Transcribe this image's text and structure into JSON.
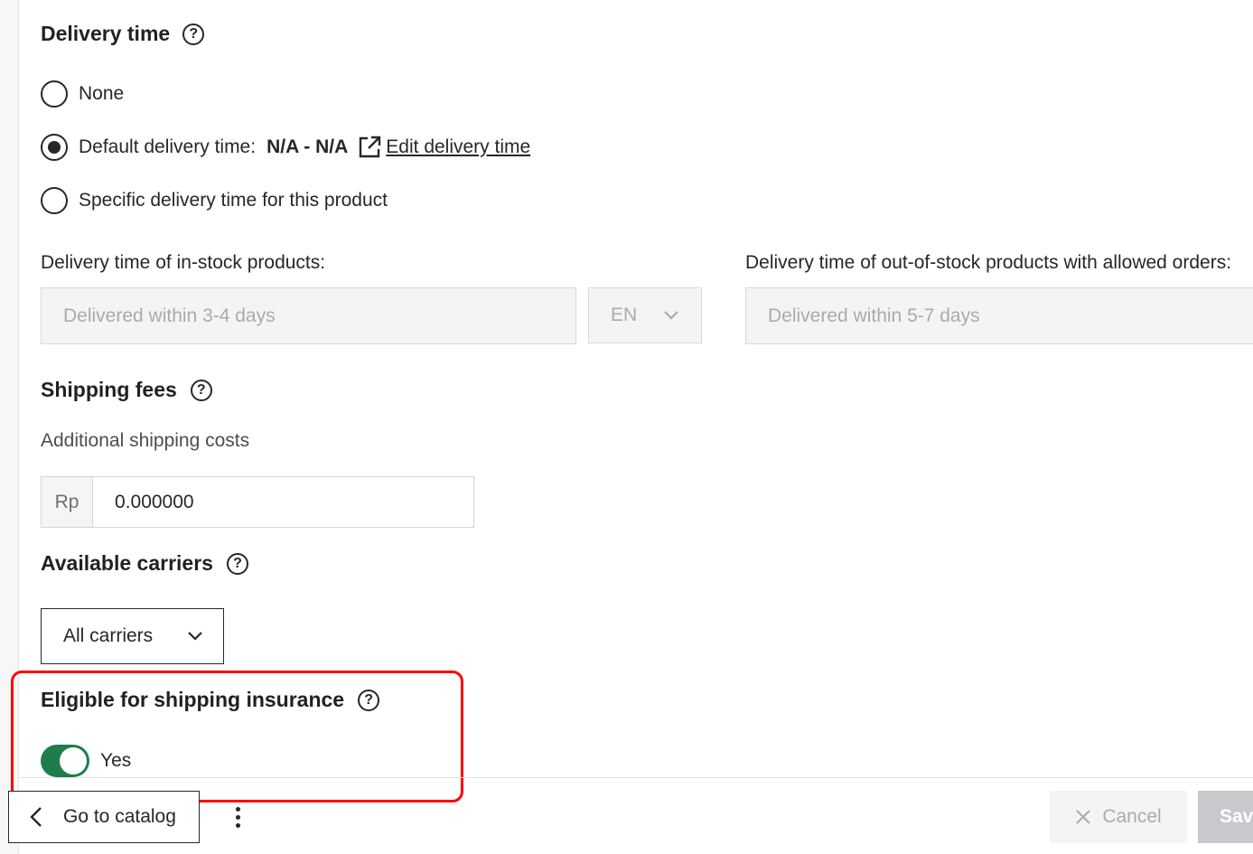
{
  "delivery_time": {
    "heading": "Delivery time",
    "options": {
      "none": "None",
      "default_label": "Default delivery time:",
      "default_value": "N/A - N/A",
      "edit_link": "Edit delivery time",
      "specific": "Specific delivery time for this product"
    },
    "selected": "default",
    "in_stock_label": "Delivery time of in-stock products:",
    "in_stock_placeholder": "Delivered within 3-4 days",
    "language": "EN",
    "out_of_stock_label": "Delivery time of out-of-stock products with allowed orders:",
    "out_of_stock_placeholder": "Delivered within 5-7 days"
  },
  "shipping_fees": {
    "heading": "Shipping fees",
    "label": "Additional shipping costs",
    "currency": "Rp",
    "value": "0.000000"
  },
  "carriers": {
    "heading": "Available carriers",
    "selected": "All carriers"
  },
  "insurance": {
    "heading": "Eligible for shipping insurance",
    "toggle_label": "Yes",
    "enabled": true
  },
  "footer": {
    "back_label": "Go to catalog",
    "cancel_label": "Cancel",
    "save_label": "Sav"
  },
  "colors": {
    "toggle_on": "#1e7d4b",
    "highlight": "#ff0000",
    "text": "#25272a"
  }
}
